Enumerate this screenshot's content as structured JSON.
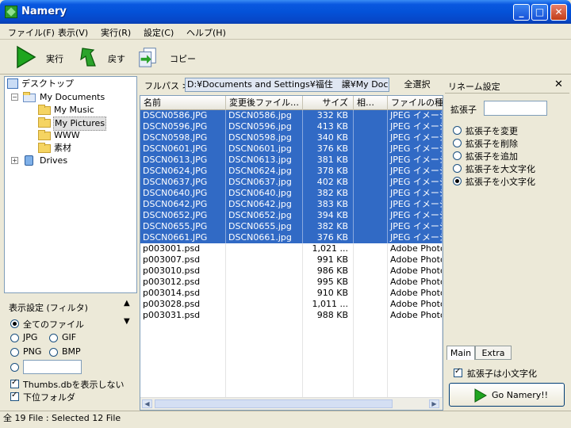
{
  "window": {
    "title": "Namery"
  },
  "menu": [
    "ファイル(F)",
    "表示(V)",
    "実行(R)",
    "設定(C)",
    "ヘルプ(H)"
  ],
  "toolbar": {
    "run": "実行",
    "back": "戻す",
    "copy": "コピー"
  },
  "tree": {
    "root": "デスクトップ",
    "my_documents": "My Documents",
    "children": [
      "My Music",
      "My Pictures",
      "WWW",
      "素材"
    ],
    "drives": "Drives"
  },
  "filter": {
    "title": "表示設定 (フィルタ)",
    "all_files": "全てのファイル",
    "jpg": "JPG",
    "gif": "GIF",
    "png": "PNG",
    "bmp": "BMP",
    "hide_thumbs": "Thumbs.dbを表示しない",
    "subfolders": "下位フォルダ"
  },
  "path": {
    "label": "フルパス >",
    "value": "D:¥Documents and Settings¥福住　譲¥My Documents¥My Pictures",
    "select_all": "全選択"
  },
  "columns": [
    "名前",
    "変更後ファイル…",
    "サイズ",
    "相…",
    "ファイルの種類"
  ],
  "files": [
    {
      "name": "DSCN0586.JPG",
      "new": "DSCN0586.jpg",
      "size": "332 KB",
      "type": "JPEG イメージ",
      "selected": true
    },
    {
      "name": "DSCN0596.JPG",
      "new": "DSCN0596.jpg",
      "size": "413 KB",
      "type": "JPEG イメージ",
      "selected": true
    },
    {
      "name": "DSCN0598.JPG",
      "new": "DSCN0598.jpg",
      "size": "340 KB",
      "type": "JPEG イメージ",
      "selected": true
    },
    {
      "name": "DSCN0601.JPG",
      "new": "DSCN0601.jpg",
      "size": "376 KB",
      "type": "JPEG イメージ",
      "selected": true
    },
    {
      "name": "DSCN0613.JPG",
      "new": "DSCN0613.jpg",
      "size": "381 KB",
      "type": "JPEG イメージ",
      "selected": true
    },
    {
      "name": "DSCN0624.JPG",
      "new": "DSCN0624.jpg",
      "size": "378 KB",
      "type": "JPEG イメージ",
      "selected": true
    },
    {
      "name": "DSCN0637.JPG",
      "new": "DSCN0637.jpg",
      "size": "402 KB",
      "type": "JPEG イメージ",
      "selected": true
    },
    {
      "name": "DSCN0640.JPG",
      "new": "DSCN0640.jpg",
      "size": "382 KB",
      "type": "JPEG イメージ",
      "selected": true
    },
    {
      "name": "DSCN0642.JPG",
      "new": "DSCN0642.jpg",
      "size": "383 KB",
      "type": "JPEG イメージ",
      "selected": true
    },
    {
      "name": "DSCN0652.JPG",
      "new": "DSCN0652.jpg",
      "size": "394 KB",
      "type": "JPEG イメージ",
      "selected": true
    },
    {
      "name": "DSCN0655.JPG",
      "new": "DSCN0655.jpg",
      "size": "382 KB",
      "type": "JPEG イメージ",
      "selected": true
    },
    {
      "name": "DSCN0661.JPG",
      "new": "DSCN0661.jpg",
      "size": "376 KB",
      "type": "JPEG イメージ",
      "selected": true
    },
    {
      "name": "p003001.psd",
      "new": "",
      "size": "1,021 ...",
      "type": "Adobe Photoshop",
      "selected": false
    },
    {
      "name": "p003007.psd",
      "new": "",
      "size": "991 KB",
      "type": "Adobe Photoshop",
      "selected": false
    },
    {
      "name": "p003010.psd",
      "new": "",
      "size": "986 KB",
      "type": "Adobe Photoshop",
      "selected": false
    },
    {
      "name": "p003012.psd",
      "new": "",
      "size": "995 KB",
      "type": "Adobe Photoshop",
      "selected": false
    },
    {
      "name": "p003014.psd",
      "new": "",
      "size": "910 KB",
      "type": "Adobe Photoshop",
      "selected": false
    },
    {
      "name": "p003028.psd",
      "new": "",
      "size": "1,011 ...",
      "type": "Adobe Photoshop",
      "selected": false
    },
    {
      "name": "p003031.psd",
      "new": "",
      "size": "988 KB",
      "type": "Adobe Photoshop",
      "selected": false
    }
  ],
  "rename": {
    "title": "リネーム設定",
    "ext_label": "拡張子",
    "ext_value": "",
    "options": [
      "拡張子を変更",
      "拡張子を削除",
      "拡張子を追加",
      "拡張子を大文字化",
      "拡張子を小文字化"
    ],
    "selected_option": 4,
    "tabs": [
      "Main",
      "Extra"
    ],
    "summary": "拡張子は小文字化",
    "go": "Go Namery!!"
  },
  "status": "全 19 File : Selected 12 File",
  "colors": {
    "selection": "#316ac5",
    "titlebar": "#0452d8",
    "go_arrow": "#1fa51f"
  }
}
